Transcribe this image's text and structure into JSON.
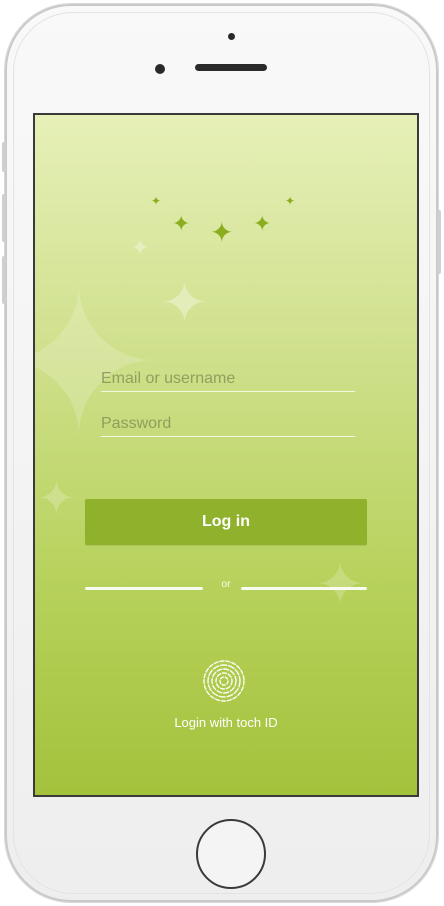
{
  "login": {
    "email_placeholder": "Email or username",
    "password_placeholder": "Password",
    "login_button": "Log in",
    "separator": "or",
    "touch_id_label": "Login with toch ID"
  },
  "icons": {
    "stars": "sparkle-stars",
    "fingerprint": "fingerprint-icon"
  },
  "colors": {
    "accent": "#8fb12c",
    "gradient_top": "#e6f0b8",
    "gradient_bottom": "#a3c23c"
  }
}
